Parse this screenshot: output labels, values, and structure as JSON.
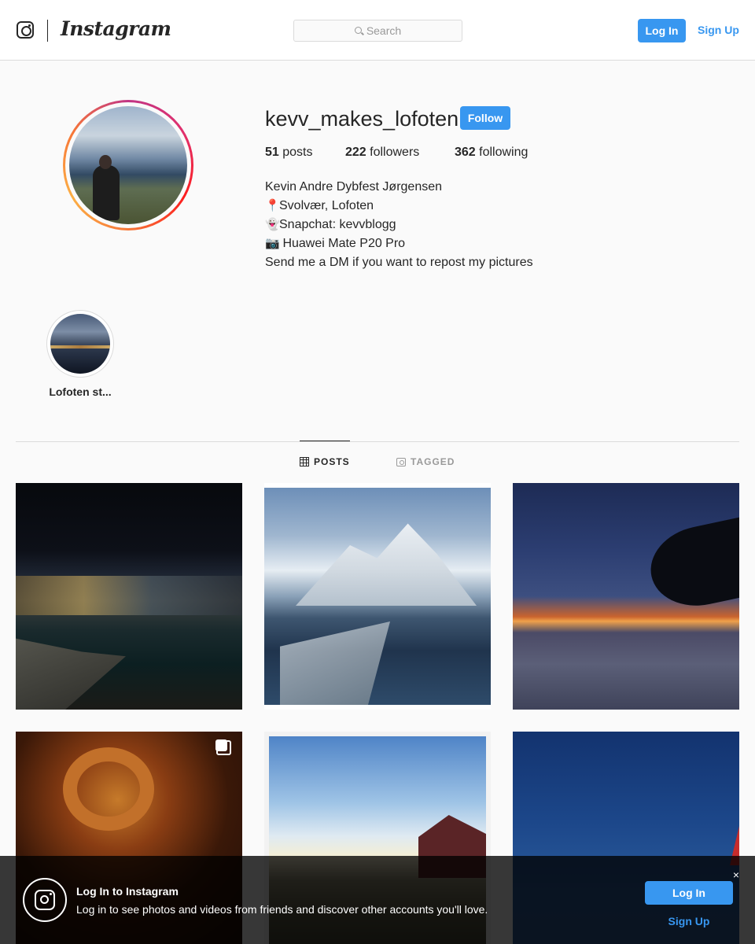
{
  "nav": {
    "logo_icon": "instagram-glyph-icon",
    "wordmark": "Instagram",
    "search_placeholder": "Search",
    "login_label": "Log In",
    "signup_label": "Sign Up"
  },
  "profile": {
    "username": "kevv_makes_lofoten",
    "follow_label": "Follow",
    "stats": {
      "posts_count": "51",
      "posts_label": " posts",
      "followers_count": "222",
      "followers_label": " followers",
      "following_count": "362",
      "following_label": " following"
    },
    "bio": {
      "name": "Kevin Andre Dybfest Jørgensen",
      "line_location_emoji": "📍",
      "line_location": "Svolvær, Lofoten",
      "line_snapchat_emoji": "👻",
      "line_snapchat": "Snapchat: kevvblogg",
      "line_camera_emoji": "📷",
      "line_camera": " Huawei Mate P20 Pro",
      "line_dm": "Send me a DM if you want to repost my pictures"
    }
  },
  "highlights": [
    {
      "label": "Lofoten st..."
    }
  ],
  "tabs": {
    "posts_label": "POSTS",
    "tagged_label": "TAGGED",
    "active": "POSTS"
  },
  "login_bar": {
    "title": "Log In to Instagram",
    "text": "Log in to see photos and videos from friends and discover other accounts you'll love.",
    "close_glyph": "×",
    "login_label": "Log In",
    "signup_label": "Sign Up"
  },
  "colors": {
    "accent": "#3897f0",
    "text": "#262626",
    "muted": "#999999",
    "border": "#dbdbdb",
    "background": "#fafafa"
  }
}
